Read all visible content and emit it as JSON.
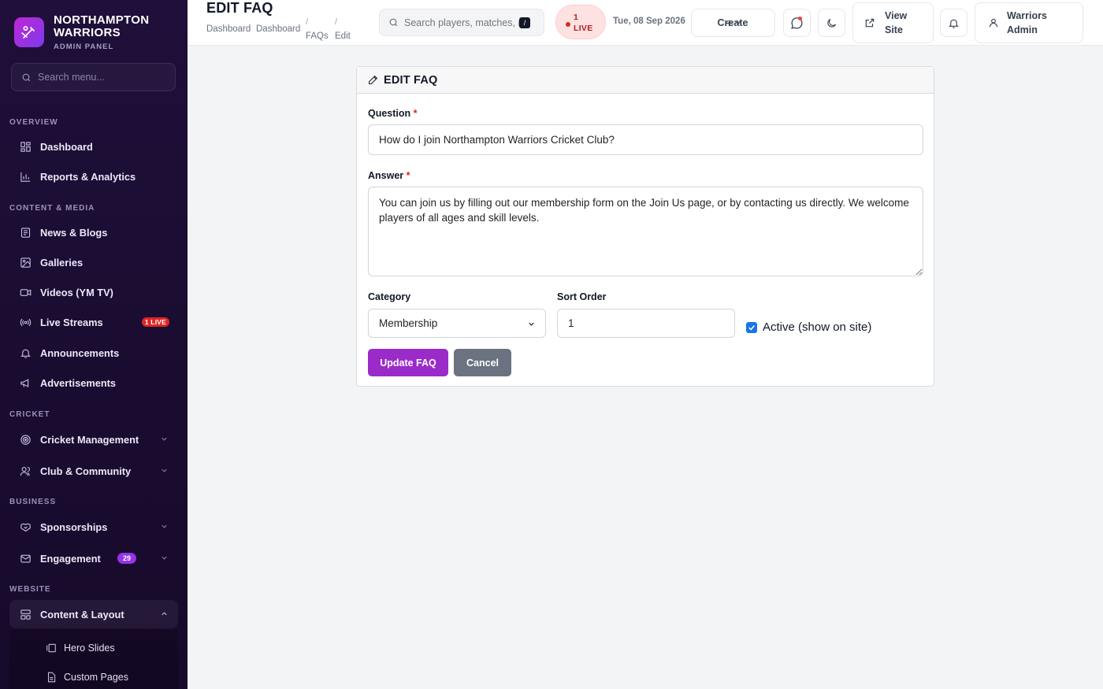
{
  "brand": {
    "name": "NORTHAMPTON WARRIORS",
    "subtitle": "ADMIN PANEL",
    "menu_search_placeholder": "Search menu..."
  },
  "sidebar": {
    "sections": [
      {
        "label": "OVERVIEW"
      },
      {
        "label": "CONTENT & MEDIA"
      },
      {
        "label": "CRICKET"
      },
      {
        "label": "BUSINESS"
      },
      {
        "label": "WEBSITE"
      }
    ],
    "items": [
      {
        "label": "Dashboard",
        "icon": "dashboard-icon"
      },
      {
        "label": "Reports & Analytics",
        "icon": "bar-chart-icon"
      },
      {
        "label": "News & Blogs",
        "icon": "newspaper-icon"
      },
      {
        "label": "Galleries",
        "icon": "image-icon"
      },
      {
        "label": "Videos (YM TV)",
        "icon": "video-icon"
      },
      {
        "label": "Live Streams",
        "icon": "broadcast-icon",
        "badge": "1 LIVE"
      },
      {
        "label": "Announcements",
        "icon": "bell-icon"
      },
      {
        "label": "Advertisements",
        "icon": "megaphone-icon"
      },
      {
        "label": "Cricket Management",
        "icon": "target-icon"
      },
      {
        "label": "Club & Community",
        "icon": "users-icon"
      },
      {
        "label": "Sponsorships",
        "icon": "handshake-icon"
      },
      {
        "label": "Engagement",
        "icon": "mail-icon",
        "badge": "29"
      },
      {
        "label": "Content & Layout",
        "icon": "layout-icon"
      }
    ],
    "sub_items": [
      {
        "label": "Hero Slides",
        "icon": "slides-icon"
      },
      {
        "label": "Custom Pages",
        "icon": "file-icon"
      }
    ]
  },
  "header": {
    "title": "EDIT FAQ",
    "breadcrumbs": [
      "Dashboard",
      "Dashboard",
      "FAQs",
      "Edit"
    ],
    "separator": "/",
    "search_placeholder": "Search players, matches, news...",
    "search_shortcut": "/",
    "live_count": "1",
    "live_label": "LIVE",
    "date": "Tue, 08 Sep 2026",
    "create_label": "Create",
    "view_site_line1": "View",
    "view_site_line2": "Site",
    "user_line1": "Warriors",
    "user_line2": "Admin"
  },
  "form": {
    "title": "EDIT FAQ",
    "question_label": "Question",
    "question_value": "How do I join Northampton Warriors Cricket Club?",
    "answer_label": "Answer",
    "answer_value": "You can join us by filling out our membership form on the Join Us page, or by contacting us directly. We welcome players of all ages and skill levels.",
    "required_mark": "*",
    "category_label": "Category",
    "category_value": "Membership",
    "sort_label": "Sort Order",
    "sort_value": "1",
    "active_label": "Active (show on site)",
    "active_checked": true,
    "update_label": "Update FAQ",
    "cancel_label": "Cancel"
  },
  "colors": {
    "sidebar_bg": "#1f0f3a",
    "primary": "#9b2bc9",
    "secondary": "#6b7280",
    "live": "#dc2626",
    "checkbox": "#1a73e8"
  }
}
